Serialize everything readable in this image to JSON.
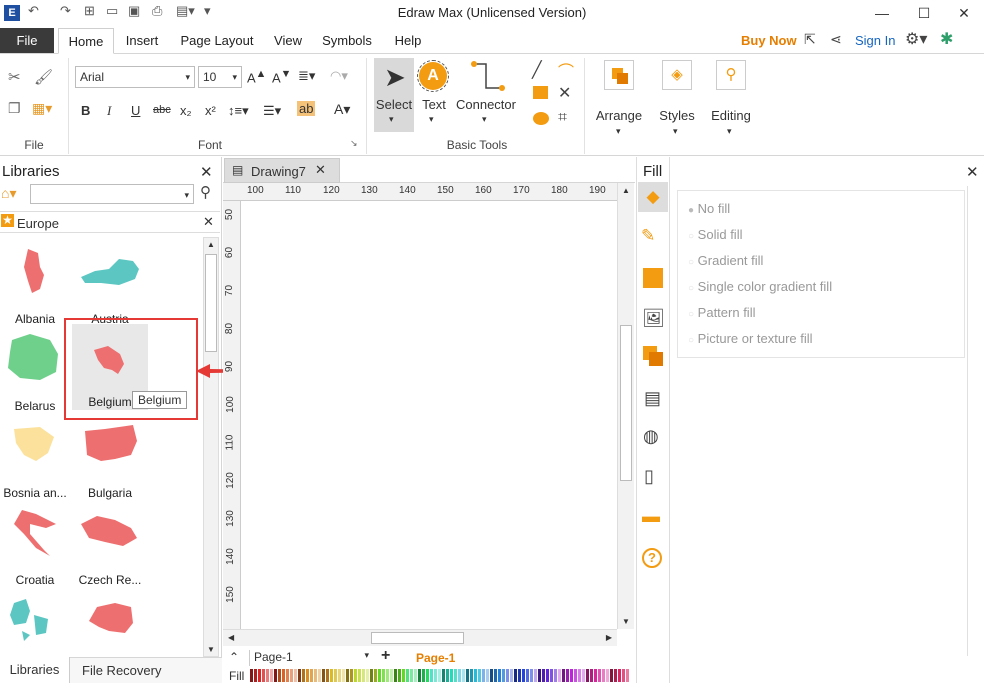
{
  "window": {
    "title": "Edraw Max (Unlicensed Version)",
    "minimize": "—",
    "maximize": "☐",
    "close": "✕"
  },
  "menu": {
    "file": "File",
    "tabs": [
      "Home",
      "Insert",
      "Page Layout",
      "View",
      "Symbols",
      "Help"
    ],
    "buy_now": "Buy Now",
    "sign_in": "Sign In"
  },
  "ribbon": {
    "groups": {
      "file": "File",
      "font": "Font",
      "basic_tools": "Basic Tools"
    },
    "font_name": "Arial",
    "font_size": "10",
    "tools": {
      "select": "Select",
      "text": "Text",
      "connector": "Connector",
      "arrange": "Arrange",
      "styles": "Styles",
      "editing": "Editing"
    },
    "format_buttons": [
      "B",
      "I",
      "U",
      "abc",
      "x₂",
      "x²"
    ]
  },
  "libraries": {
    "title": "Libraries",
    "search_placeholder": "",
    "category": "Europe",
    "items": [
      "Albania",
      "Austria",
      "Belarus",
      "Belgium",
      "Bosnia an...",
      "Bulgaria",
      "Croatia",
      "Czech Re...",
      ""
    ],
    "tooltip": "Belgium",
    "bottom_tabs": [
      "Libraries",
      "File Recovery"
    ]
  },
  "document": {
    "tab": "Drawing7",
    "ruler_h": [
      "100",
      "110",
      "120",
      "130",
      "140",
      "150",
      "160",
      "170",
      "180",
      "190"
    ],
    "ruler_v": [
      "50",
      "60",
      "70",
      "80",
      "90",
      "100",
      "110",
      "120",
      "130",
      "140",
      "150"
    ],
    "page_select": "Page-1",
    "page_tab": "Page-1",
    "fill_label": "Fill"
  },
  "fill_panel": {
    "title": "Fill",
    "options": [
      "No fill",
      "Solid fill",
      "Gradient fill",
      "Single color gradient fill",
      "Pattern fill",
      "Picture or texture fill"
    ]
  },
  "colors": {
    "accent": "#f39c12",
    "menu_orange": "#e67e00",
    "link": "#1565c0",
    "highlight": "#e53935"
  }
}
